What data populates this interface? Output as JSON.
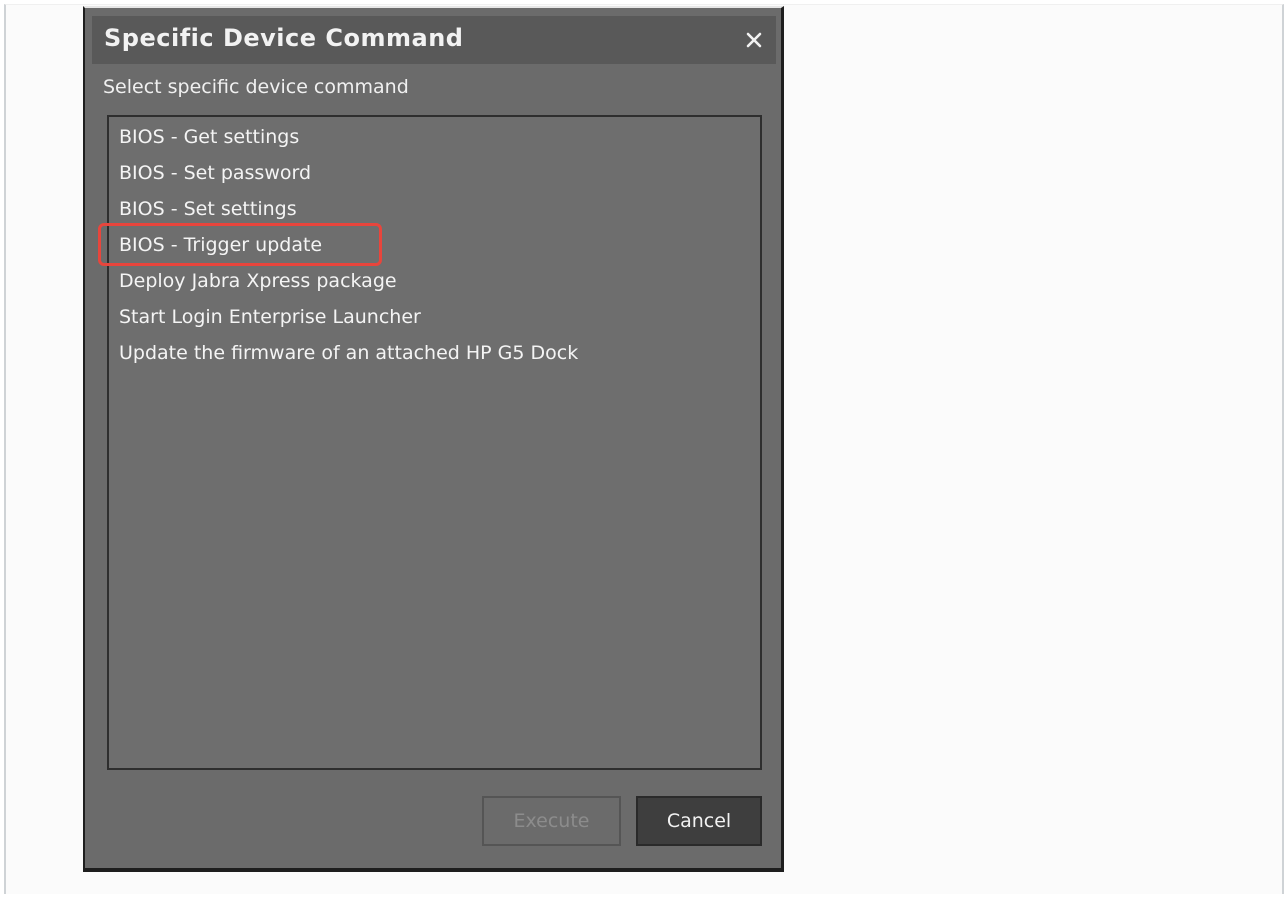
{
  "dialog": {
    "title": "Specific Device Command",
    "close_icon": "close-icon",
    "subtitle": "Select specific device command",
    "commands": [
      "BIOS - Get settings",
      "BIOS - Set password",
      "BIOS - Set settings",
      "BIOS - Trigger update",
      "Deploy Jabra Xpress package",
      "Start Login Enterprise Launcher",
      "Update the firmware of an attached HP G5 Dock"
    ],
    "highlighted_command": "BIOS - Trigger update",
    "execute_label": "Execute",
    "cancel_label": "Cancel"
  },
  "colors": {
    "dialog_bg": "#6b6b6b",
    "titlebar_bg": "#595959",
    "highlight": "#e8453c",
    "text": "#f4f4f4",
    "disabled_text": "#8c8c8c"
  }
}
